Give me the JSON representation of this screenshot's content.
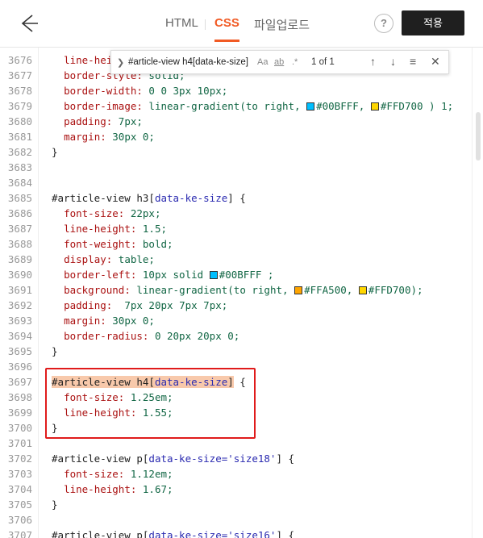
{
  "header": {
    "tabs": [
      {
        "label": "HTML"
      },
      {
        "label": "CSS"
      },
      {
        "label": "파일업로드"
      }
    ],
    "help_label": "?",
    "apply_label": "적용"
  },
  "search": {
    "query": "#article-view h4[data-ke-size]",
    "match_case": "Aa",
    "whole_word": "ab",
    "regex": ".*",
    "count": "1 of 1"
  },
  "colors": {
    "accent": "#f15a24",
    "cyan": "#00BFFF",
    "gold": "#FFD700",
    "orange": "#FFA500",
    "annotation": "#e01b1b"
  },
  "code": {
    "lines": [
      {
        "n": "3676",
        "t": "  line-height: 1;"
      },
      {
        "n": "3677",
        "t": "  border-style: solid;"
      },
      {
        "n": "3678",
        "t": "  border-width: 0 0 3px 10px;"
      },
      {
        "n": "3679",
        "t": "  border-image: linear-gradient(to right, #00BFFF, #FFD700 ) 1;"
      },
      {
        "n": "3680",
        "t": "  padding: 7px;"
      },
      {
        "n": "3681",
        "t": "  margin: 30px 0;"
      },
      {
        "n": "3682",
        "t": "}"
      },
      {
        "n": "3683",
        "t": ""
      },
      {
        "n": "3684",
        "t": ""
      },
      {
        "n": "3685",
        "t": "#article-view h3[data-ke-size] {"
      },
      {
        "n": "3686",
        "t": "  font-size: 22px;"
      },
      {
        "n": "3687",
        "t": "  line-height: 1.5;"
      },
      {
        "n": "3688",
        "t": "  font-weight: bold;"
      },
      {
        "n": "3689",
        "t": "  display: table;"
      },
      {
        "n": "3690",
        "t": "  border-left: 10px solid #00BFFF ;"
      },
      {
        "n": "3691",
        "t": "  background: linear-gradient(to right, #FFA500, #FFD700);"
      },
      {
        "n": "3692",
        "t": "  padding:  7px 20px 7px 7px;"
      },
      {
        "n": "3693",
        "t": "  margin: 30px 0;"
      },
      {
        "n": "3694",
        "t": "  border-radius: 0 20px 20px 0;"
      },
      {
        "n": "3695",
        "t": "}"
      },
      {
        "n": "3696",
        "t": ""
      },
      {
        "n": "3697",
        "t": "#article-view h4[data-ke-size] {"
      },
      {
        "n": "3698",
        "t": "  font-size: 1.25em;"
      },
      {
        "n": "3699",
        "t": "  line-height: 1.55;"
      },
      {
        "n": "3700",
        "t": "}"
      },
      {
        "n": "3701",
        "t": ""
      },
      {
        "n": "3702",
        "t": "#article-view p[data-ke-size='size18'] {"
      },
      {
        "n": "3703",
        "t": "  font-size: 1.12em;"
      },
      {
        "n": "3704",
        "t": "  line-height: 1.67;"
      },
      {
        "n": "3705",
        "t": "}"
      },
      {
        "n": "3706",
        "t": ""
      },
      {
        "n": "3707",
        "t": "#article-view p[data-ke-size='size16'] {"
      }
    ]
  }
}
